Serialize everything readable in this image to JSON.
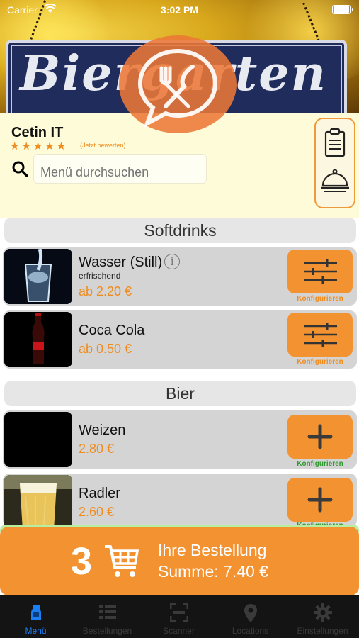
{
  "status_bar": {
    "carrier": "Carrier",
    "time": "3:02 PM"
  },
  "header": {
    "sign_text": "Biergarten"
  },
  "restaurant": {
    "name": "Cetin IT",
    "stars": "★★★★★",
    "rating": 5,
    "rate_link": "(Jetzt bewerten)"
  },
  "search": {
    "placeholder": "Menü durchsuchen",
    "value": ""
  },
  "side_panel": {
    "icons": [
      "clipboard-icon",
      "cloche-icon"
    ]
  },
  "menu": {
    "sections": [
      {
        "title": "Softdrinks",
        "items": [
          {
            "name": "Wasser (Still)",
            "info": "i",
            "description": "erfrischend",
            "price": "ab 2.20 €",
            "action_label": "Konfigurieren",
            "action_icon": "sliders-icon"
          },
          {
            "name": "Coca Cola",
            "description": "",
            "price": "ab 0.50 €",
            "action_label": "Konfigurieren",
            "action_icon": "sliders-icon"
          }
        ]
      },
      {
        "title": "Bier",
        "items": [
          {
            "name": "Weizen",
            "description": "",
            "price": "2.80 €",
            "action_label": "Konfigurieren",
            "action_icon": "plus-icon"
          },
          {
            "name": "Radler",
            "description": "",
            "price": "2.60 €",
            "action_label": "Konfigurieren",
            "action_icon": "plus-icon"
          }
        ]
      }
    ]
  },
  "order": {
    "count": "3",
    "title": "Ihre Bestellung",
    "sum": "Summe: 7.40 €"
  },
  "tabs": [
    {
      "label": "Menü",
      "icon": "menu-drink-icon",
      "active": true
    },
    {
      "label": "Bestellungen",
      "icon": "list-icon",
      "active": false
    },
    {
      "label": "Scanner",
      "icon": "scanner-icon",
      "active": false
    },
    {
      "label": "Locations",
      "icon": "location-pin-icon",
      "active": false
    },
    {
      "label": "Einstellungen",
      "icon": "gear-icon",
      "active": false
    }
  ],
  "colors": {
    "accent_orange": "#f39231",
    "price_orange": "#f08c1e",
    "active_tab": "#1a7ff5",
    "config_label_orange": "#f08c1e",
    "config_label_green": "#2e9a2e",
    "info_background": "#fefbd8"
  }
}
